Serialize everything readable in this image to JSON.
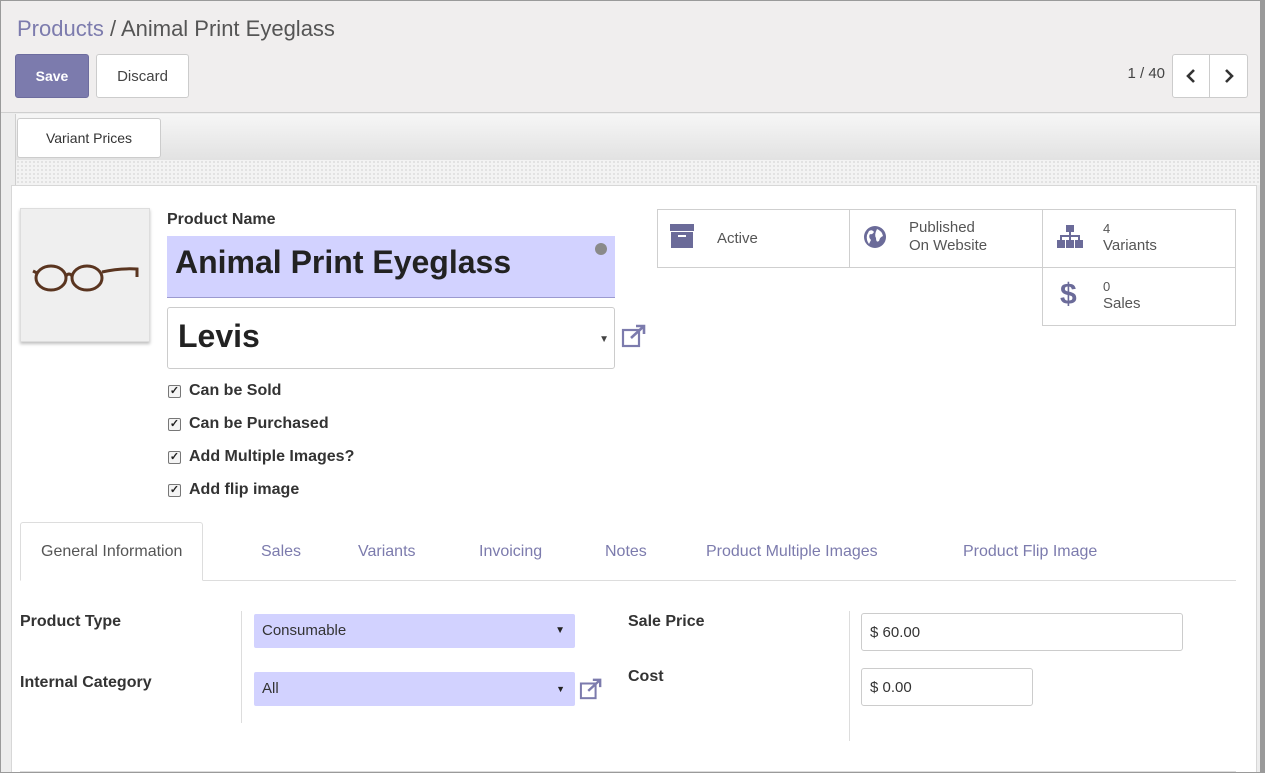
{
  "breadcrumb": {
    "parent": "Products",
    "separator": " / ",
    "current": "Animal Print Eyeglass"
  },
  "toolbar": {
    "save_label": "Save",
    "discard_label": "Discard"
  },
  "pager": {
    "value": "1 / 40",
    "prev": "‹",
    "next": "›"
  },
  "header": {
    "variant_prices_label": "Variant Prices"
  },
  "product": {
    "name_label": "Product Name",
    "name": "Animal Print Eyeglass",
    "brand": "Levis",
    "checkboxes": [
      {
        "label": "Can be Sold",
        "checked": true
      },
      {
        "label": "Can be Purchased",
        "checked": true
      },
      {
        "label": "Add Multiple Images?",
        "checked": true
      },
      {
        "label": "Add flip image",
        "checked": true
      }
    ]
  },
  "smart_buttons": {
    "active": {
      "label": "Active",
      "icon": "archive-icon"
    },
    "published": {
      "line1": "Published",
      "line2": "On Website",
      "icon": "globe-icon"
    },
    "variants": {
      "count": "4",
      "label": "Variants",
      "icon": "sitemap-icon"
    },
    "sales": {
      "count": "0",
      "label": "Sales",
      "icon": "dollar-icon"
    }
  },
  "tabs": [
    {
      "label": "General Information",
      "active": true
    },
    {
      "label": "Sales"
    },
    {
      "label": "Variants"
    },
    {
      "label": "Invoicing"
    },
    {
      "label": "Notes"
    },
    {
      "label": "Product Multiple Images"
    },
    {
      "label": "Product Flip Image"
    }
  ],
  "fields": {
    "product_type": {
      "label": "Product Type",
      "value": "Consumable"
    },
    "internal_category": {
      "label": "Internal Category",
      "value": "All"
    },
    "sale_price": {
      "label": "Sale Price",
      "value": "$ 60.00"
    },
    "cost": {
      "label": "Cost",
      "value": "$ 0.00"
    }
  },
  "colors": {
    "primary": "#7c7bad",
    "required_field": "#d2d2ff",
    "active_icon": "#6b6b99"
  }
}
